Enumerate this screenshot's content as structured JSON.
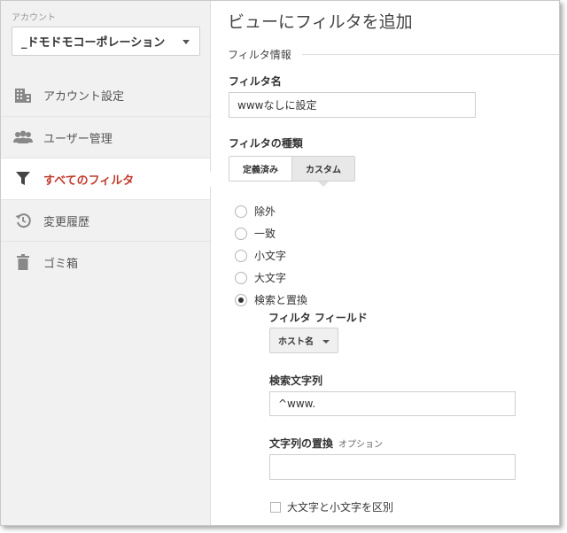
{
  "sidebar": {
    "account_label": "アカウント",
    "account_name": "_ドモドモコーポレーション",
    "items": [
      {
        "label": "アカウント設定",
        "icon": "building-icon",
        "active": false
      },
      {
        "label": "ユーザー管理",
        "icon": "users-icon",
        "active": false
      },
      {
        "label": "すべてのフィルタ",
        "icon": "filter-icon",
        "active": true
      },
      {
        "label": "変更履歴",
        "icon": "history-icon",
        "active": false
      },
      {
        "label": "ゴミ箱",
        "icon": "trash-icon",
        "active": false
      }
    ]
  },
  "main": {
    "title": "ビューにフィルタを追加",
    "section_title": "フィルタ情報",
    "filter_name_label": "フィルタ名",
    "filter_name_value": "wwwなしに設定",
    "filter_type_label": "フィルタの種類",
    "type_tabs": [
      {
        "label": "定義済み",
        "selected": false
      },
      {
        "label": "カスタム",
        "selected": true
      }
    ],
    "options": [
      {
        "label": "除外",
        "checked": false
      },
      {
        "label": "一致",
        "checked": false
      },
      {
        "label": "小文字",
        "checked": false
      },
      {
        "label": "大文字",
        "checked": false
      },
      {
        "label": "検索と置換",
        "checked": true
      }
    ],
    "filter_field_label": "フィルタ フィールド",
    "filter_field_value": "ホスト名",
    "search_string_label": "検索文字列",
    "search_string_value": "^www.",
    "replace_string_label": "文字列の置換",
    "replace_optional": "オプション",
    "replace_string_value": "",
    "case_sensitive_label": "大文字と小文字を区別",
    "case_sensitive_checked": false
  },
  "colors": {
    "active_nav": "#c0392b",
    "sidebar_bg": "#f1f1f1"
  }
}
